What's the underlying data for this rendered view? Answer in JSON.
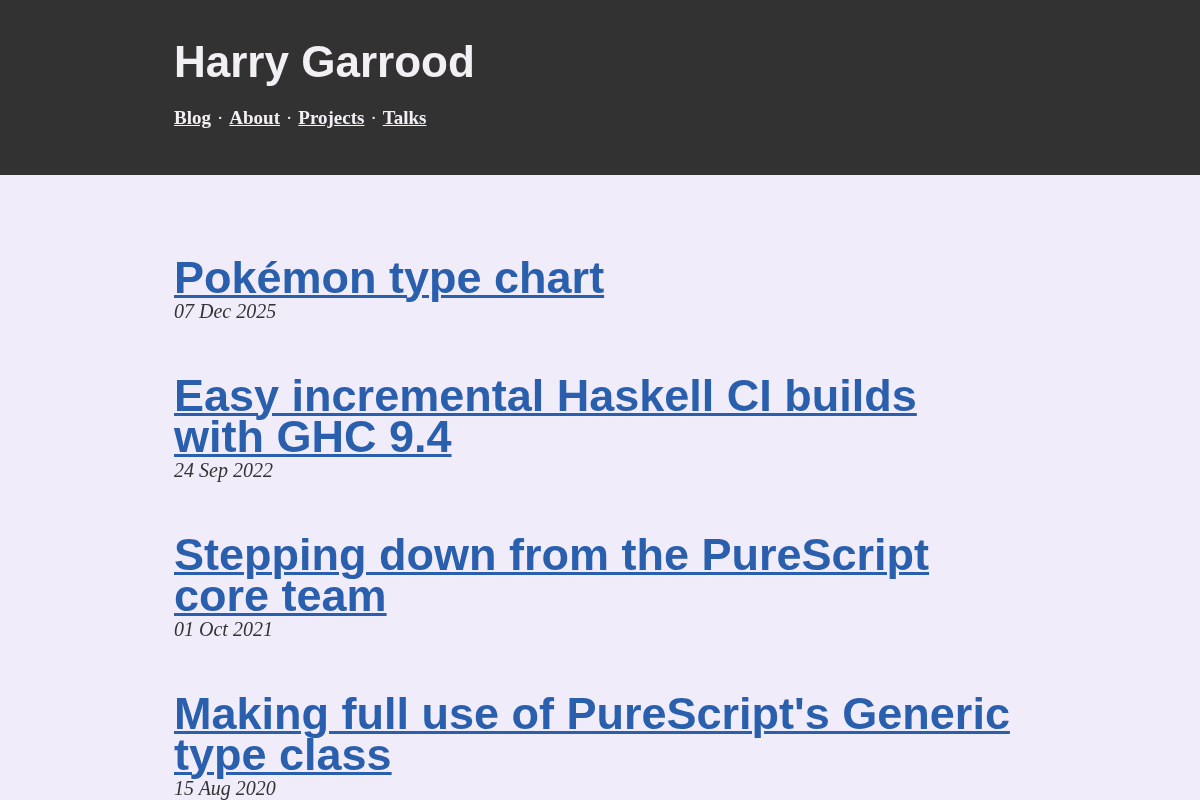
{
  "header": {
    "site_title": "Harry Garrood",
    "nav": [
      {
        "kind": "link",
        "label": "Blog"
      },
      {
        "kind": "separator",
        "label": "·"
      },
      {
        "kind": "link",
        "label": "About"
      },
      {
        "kind": "separator",
        "label": "·"
      },
      {
        "kind": "link",
        "label": "Projects"
      },
      {
        "kind": "separator",
        "label": "·"
      },
      {
        "kind": "link",
        "label": "Talks"
      }
    ]
  },
  "posts": [
    {
      "title": "Pokémon type chart",
      "date": "07 Dec 2025"
    },
    {
      "title": "Easy incremental Haskell CI builds with GHC 9.4",
      "date": "24 Sep 2022"
    },
    {
      "title": "Stepping down from the PureScript core team",
      "date": "01 Oct 2021"
    },
    {
      "title": "Making full use of PureScript's Generic type class",
      "date": "15 Aug 2020"
    }
  ]
}
